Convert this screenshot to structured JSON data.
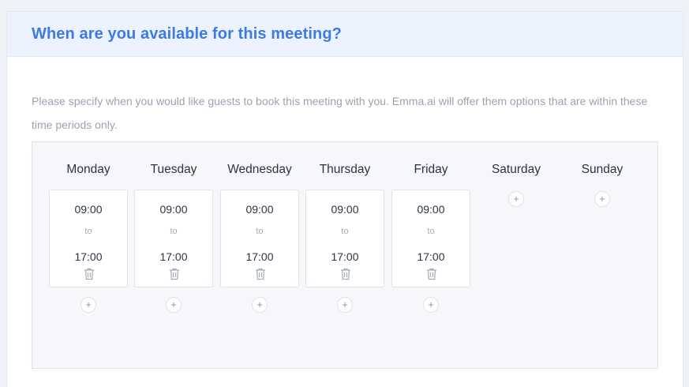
{
  "header": {
    "title": "When are you available for this meeting?"
  },
  "description": "Please specify when you would like guests to book this meeting with you. Emma.ai will offer them options that are within these time periods only.",
  "colors": {
    "accent": "#3d7ae8",
    "header_bg": "#edf3fe",
    "muted_text": "#9aa3b3"
  },
  "icons": {
    "delete": "trash-icon",
    "add": "plus-icon"
  },
  "days": [
    {
      "name": "Monday",
      "slots": [
        {
          "start": "09:00",
          "to": "to",
          "end": "17:00"
        }
      ],
      "add_label": "+"
    },
    {
      "name": "Tuesday",
      "slots": [
        {
          "start": "09:00",
          "to": "to",
          "end": "17:00"
        }
      ],
      "add_label": "+"
    },
    {
      "name": "Wednesday",
      "slots": [
        {
          "start": "09:00",
          "to": "to",
          "end": "17:00"
        }
      ],
      "add_label": "+"
    },
    {
      "name": "Thursday",
      "slots": [
        {
          "start": "09:00",
          "to": "to",
          "end": "17:00"
        }
      ],
      "add_label": "+"
    },
    {
      "name": "Friday",
      "slots": [
        {
          "start": "09:00",
          "to": "to",
          "end": "17:00"
        }
      ],
      "add_label": "+"
    },
    {
      "name": "Saturday",
      "slots": [],
      "add_label": "+"
    },
    {
      "name": "Sunday",
      "slots": [],
      "add_label": "+"
    }
  ]
}
